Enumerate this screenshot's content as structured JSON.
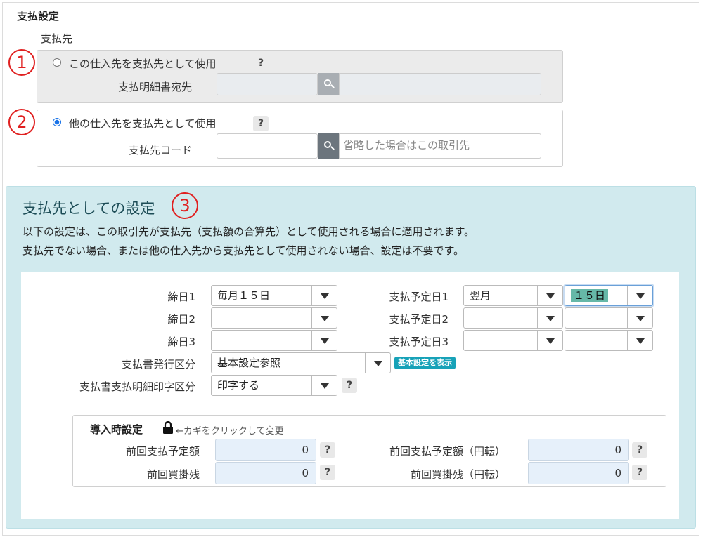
{
  "section_title": "支払設定",
  "payee_label": "支払先",
  "markers": [
    "1",
    "2",
    "3"
  ],
  "option1": {
    "label": "この仕入先を支払先として使用",
    "help": "?",
    "field_label": "支払明細書宛先",
    "selected": false
  },
  "option2": {
    "label": "他の仕入先を支払先として使用",
    "help": "?",
    "field_label": "支払先コード",
    "placeholder": "省略した場合はこの取引先",
    "selected": true
  },
  "payee_settings": {
    "title": "支払先としての設定",
    "desc1": "以下の設定は、この取引先が支払先（支払額の合算先）として使用される場合に適用されます。",
    "desc2": "支払先でない場合、または他の仕入先から支払先として使用されない場合、設定は不要です。",
    "closing_labels": [
      "締日1",
      "締日2",
      "締日3"
    ],
    "closing_values": [
      "毎月１５日",
      "",
      ""
    ],
    "payment_labels": [
      "支払予定日1",
      "支払予定日2",
      "支払予定日3"
    ],
    "payment_month": [
      "翌月",
      "",
      ""
    ],
    "payment_day": [
      "１５日",
      "",
      ""
    ],
    "issue_label": "支払書発行区分",
    "issue_value": "基本設定参照",
    "show_basic_button": "基本設定を表示",
    "print_label": "支払書支払明細印字区分",
    "print_value": "印字する",
    "print_help": "?"
  },
  "intro": {
    "title": "導入時設定",
    "lock_hint": "←カギをクリックして変更",
    "prev_planned_label": "前回支払予定額",
    "prev_planned_value": "0",
    "prev_planned_yen_label": "前回支払予定額（円転）",
    "prev_planned_yen_value": "0",
    "prev_balance_label": "前回買掛残",
    "prev_balance_value": "0",
    "prev_balance_yen_label": "前回買掛残（円転）",
    "prev_balance_yen_value": "0",
    "help": "?"
  },
  "colors": {
    "marker": "#e02020",
    "panel_bg": "#d1eaee",
    "badge": "#17a2b8",
    "highlight": "#66b8a8"
  }
}
